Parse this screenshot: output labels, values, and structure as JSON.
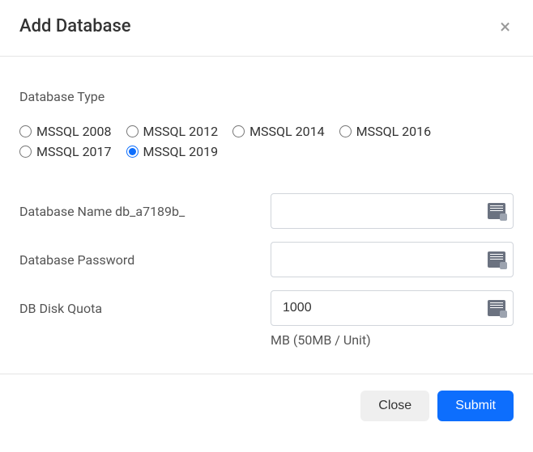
{
  "header": {
    "title": "Add Database"
  },
  "body": {
    "type_label": "Database Type",
    "radios": [
      {
        "label": "MSSQL 2008",
        "checked": false
      },
      {
        "label": "MSSQL 2012",
        "checked": false
      },
      {
        "label": "MSSQL 2014",
        "checked": false
      },
      {
        "label": "MSSQL 2016",
        "checked": false
      },
      {
        "label": "MSSQL 2017",
        "checked": false
      },
      {
        "label": "MSSQL 2019",
        "checked": true
      }
    ],
    "name_label": "Database Name db_a7189b_",
    "name_value": "",
    "password_label": "Database Password",
    "password_value": "",
    "quota_label": "DB Disk Quota",
    "quota_value": "1000",
    "quota_helper": "MB (50MB / Unit)"
  },
  "footer": {
    "close_label": "Close",
    "submit_label": "Submit"
  }
}
